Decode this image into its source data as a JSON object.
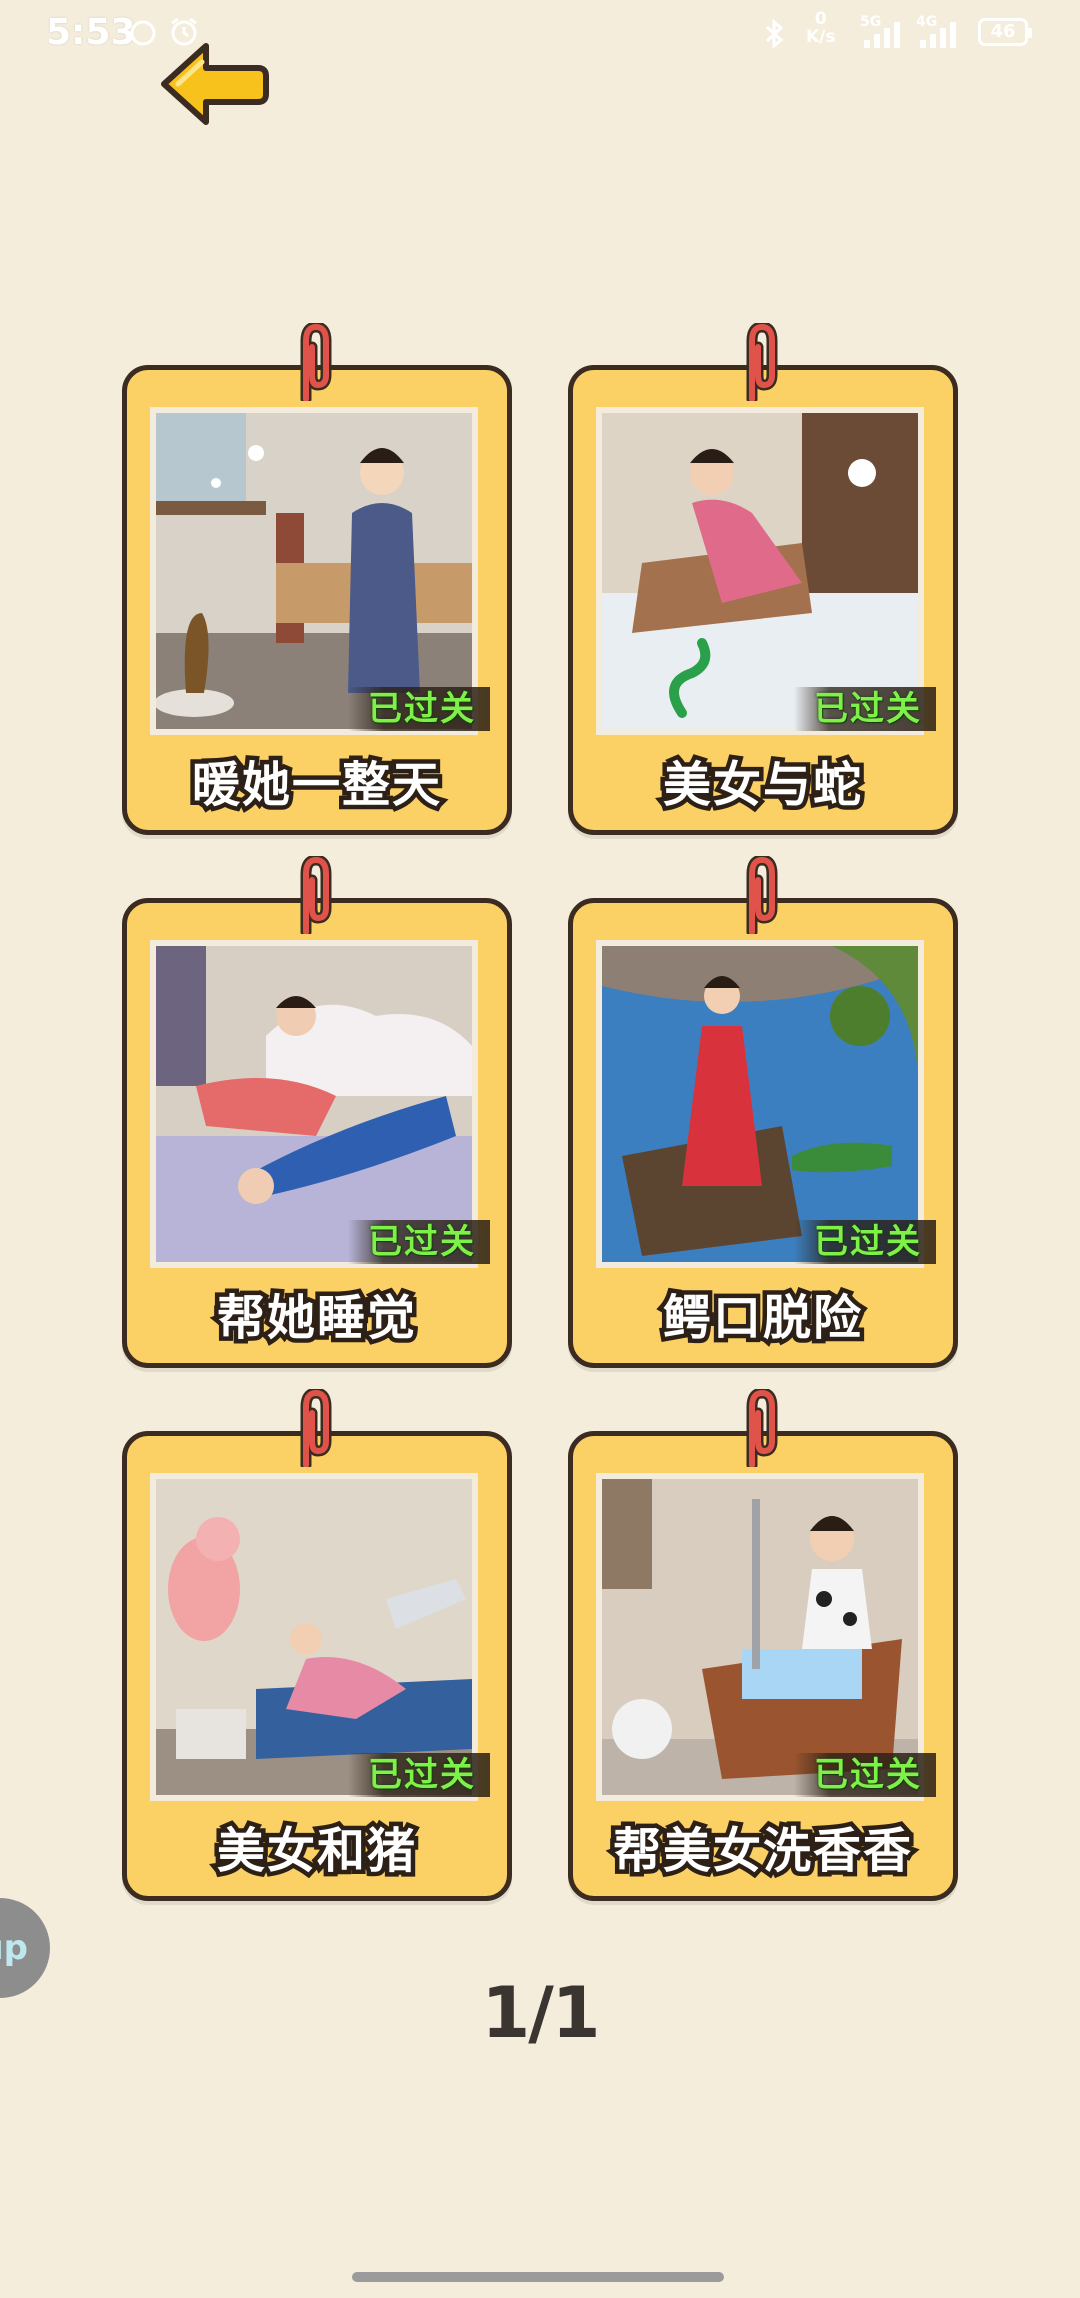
{
  "status_bar": {
    "time": "5:53",
    "network_speed_value": "0",
    "network_speed_unit": "K/s",
    "sim1_label": "5G",
    "sim2_label": "4G",
    "battery_level": "46"
  },
  "grid": {
    "cards": [
      {
        "title": "暖她一整天",
        "status": "已过关"
      },
      {
        "title": "美女与蛇",
        "status": "已过关"
      },
      {
        "title": "帮她睡觉",
        "status": "已过关"
      },
      {
        "title": "鳄口脱险",
        "status": "已过关"
      },
      {
        "title": "美女和猪",
        "status": "已过关"
      },
      {
        "title": "帮美女洗香香",
        "status": "已过关"
      }
    ]
  },
  "floating_button": {
    "label": "up"
  },
  "pagination": {
    "label": "1/1"
  },
  "colors": {
    "background": "#f4eddc",
    "card_fill": "#fbd165",
    "card_border": "#3b2b20",
    "passed_text": "#7ef04a",
    "back_arrow": "#f7c21c"
  },
  "icons": [
    "back-arrow-icon",
    "clip-icon",
    "bluetooth-icon",
    "signal-icon",
    "battery-icon",
    "alarm-icon",
    "ring-icon"
  ]
}
